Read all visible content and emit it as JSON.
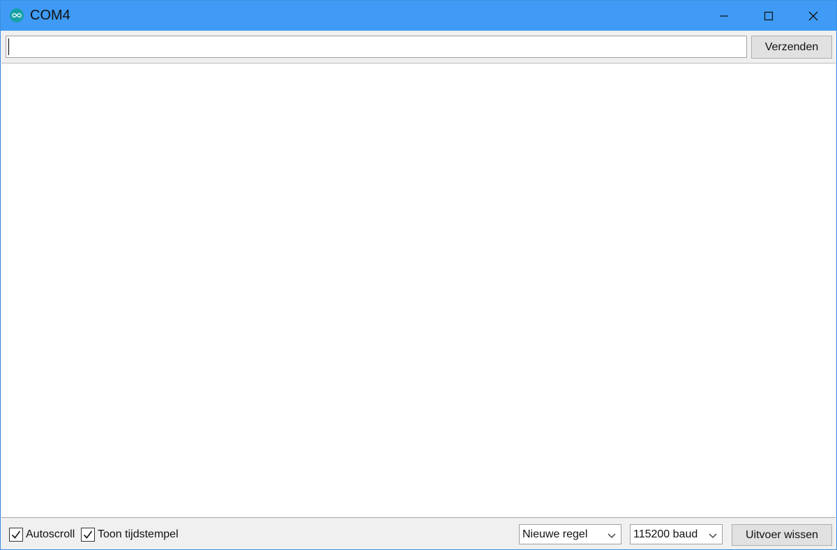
{
  "window": {
    "title": "COM4",
    "app_icon": "arduino-infinity-icon",
    "titlebar_color": "#3f9bf5",
    "controls": [
      "minimize-icon",
      "maximize-icon",
      "close-icon"
    ]
  },
  "send_bar": {
    "input_value": "",
    "send_label": "Verzenden"
  },
  "output": {
    "text": ""
  },
  "status_bar": {
    "autoscroll": {
      "label": "Autoscroll",
      "checked": true
    },
    "timestamp": {
      "label": "Toon tijdstempel",
      "checked": true
    },
    "line_ending": {
      "selected": "Nieuwe regel"
    },
    "baud_rate": {
      "selected": "115200 baud"
    },
    "clear_label": "Uitvoer wissen"
  }
}
